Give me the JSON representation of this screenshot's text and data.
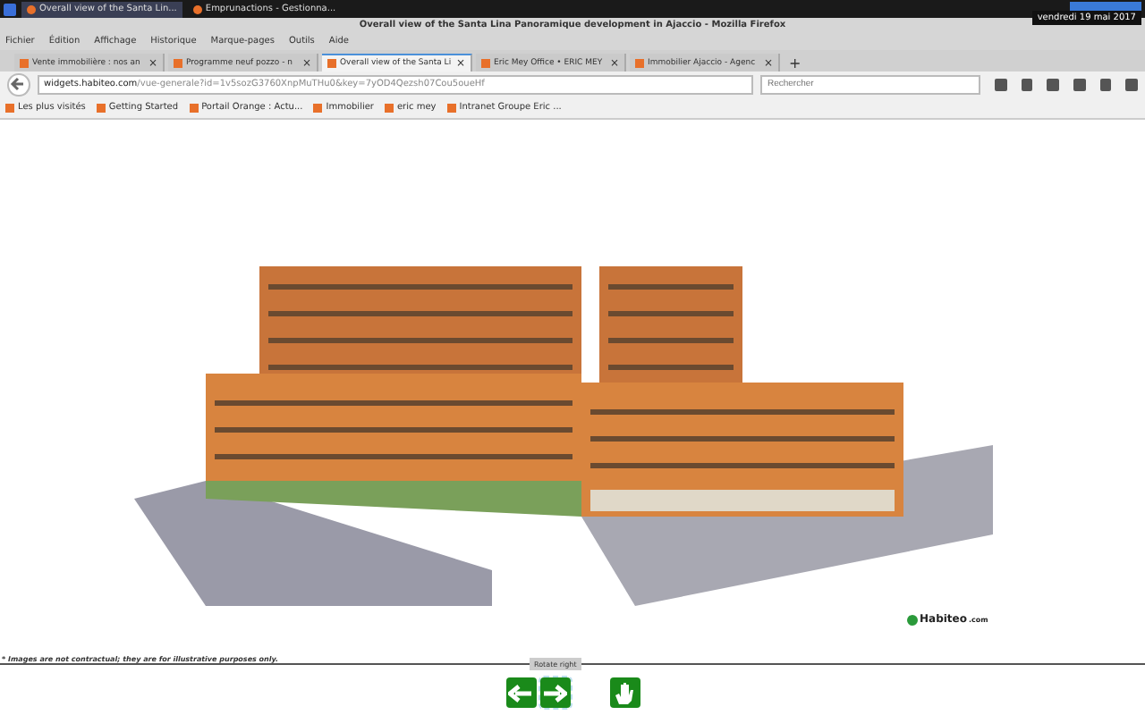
{
  "taskbar": {
    "windows": [
      {
        "label": "Overall view of the Santa Lin...",
        "selected": true
      },
      {
        "label": "Emprunactions - Gestionna...",
        "selected": false
      }
    ],
    "tooltip": "vendredi 19 mai 2017"
  },
  "window": {
    "title": "Overall view of the Santa Lina Panoramique development in Ajaccio - Mozilla Firefox"
  },
  "menu": [
    "Fichier",
    "Édition",
    "Affichage",
    "Historique",
    "Marque-pages",
    "Outils",
    "Aide"
  ],
  "tabs": [
    {
      "label": "Vente immobilière : nos an",
      "selected": false
    },
    {
      "label": "Programme neuf pozzo - n",
      "selected": false
    },
    {
      "label": "Overall view of the Santa Li",
      "selected": true
    },
    {
      "label": "Eric Mey Office • ERIC MEY",
      "selected": false
    },
    {
      "label": "Immobilier Ajaccio - Agenc",
      "selected": false
    }
  ],
  "tab_close": "×",
  "new_tab": "+",
  "address": {
    "domain": "widgets.habiteo.com",
    "path": "/vue-generale?id=1v5sozG3760XnpMuTHu0&key=7yOD4Qezsh07Cou5oueHf"
  },
  "search": {
    "placeholder": "Rechercher"
  },
  "bookmarks": [
    "Les plus visités",
    "Getting Started",
    "Portail Orange : Actu...",
    "Immobilier",
    "eric mey",
    "Intranet Groupe Eric ..."
  ],
  "page": {
    "watermark": "Habiteo",
    "watermark_suffix": ".com",
    "disclaimer": "* Images are not contractual; they are for illustrative purposes only.",
    "tooltip": "Rotate right"
  }
}
